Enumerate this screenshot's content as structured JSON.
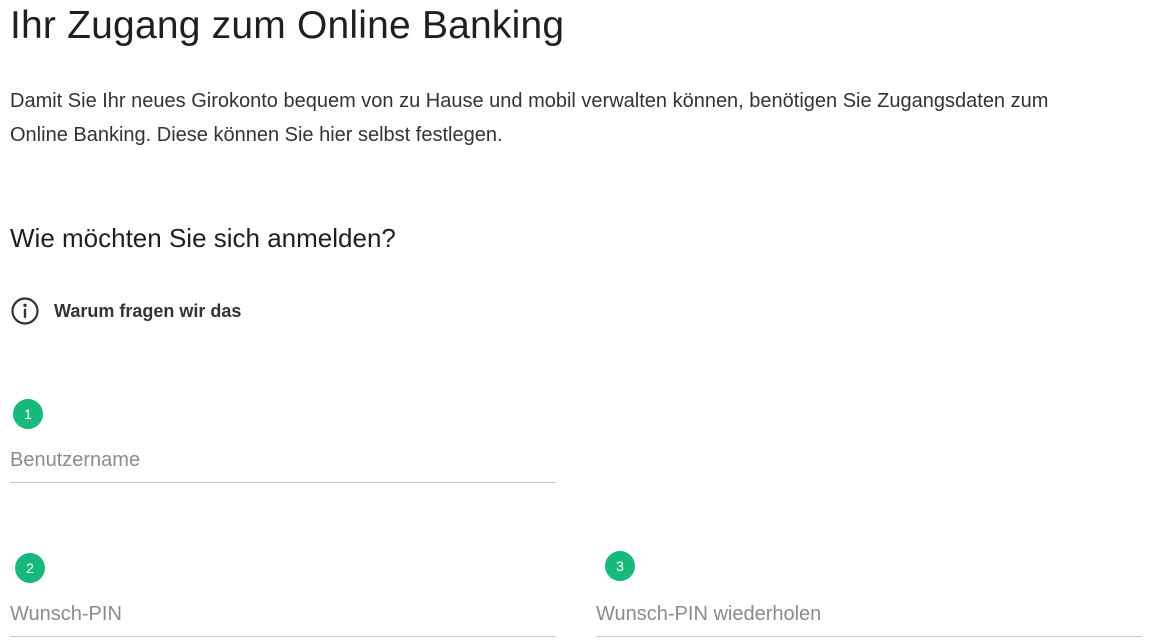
{
  "page": {
    "title": "Ihr Zugang zum Online Banking",
    "intro": "Damit Sie Ihr neues Girokonto bequem von zu Hause und mobil verwalten können, benötigen Sie Zugangsdaten zum Online Banking. Diese können Sie hier selbst festlegen."
  },
  "login_section": {
    "title": "Wie möchten Sie sich anmelden?",
    "info_link": {
      "label": "Warum fragen wir das",
      "icon": "info-circle-icon"
    }
  },
  "fields": [
    {
      "step": "1",
      "placeholder": "Benutzername",
      "value": ""
    },
    {
      "step": "2",
      "placeholder": "Wunsch-PIN",
      "value": ""
    },
    {
      "step": "3",
      "placeholder": "Wunsch-PIN wiederholen",
      "value": ""
    }
  ],
  "colors": {
    "accent": "#17b87c",
    "text": "#333333",
    "placeholder": "#8b8b8b",
    "underline": "#c9c9c9"
  }
}
